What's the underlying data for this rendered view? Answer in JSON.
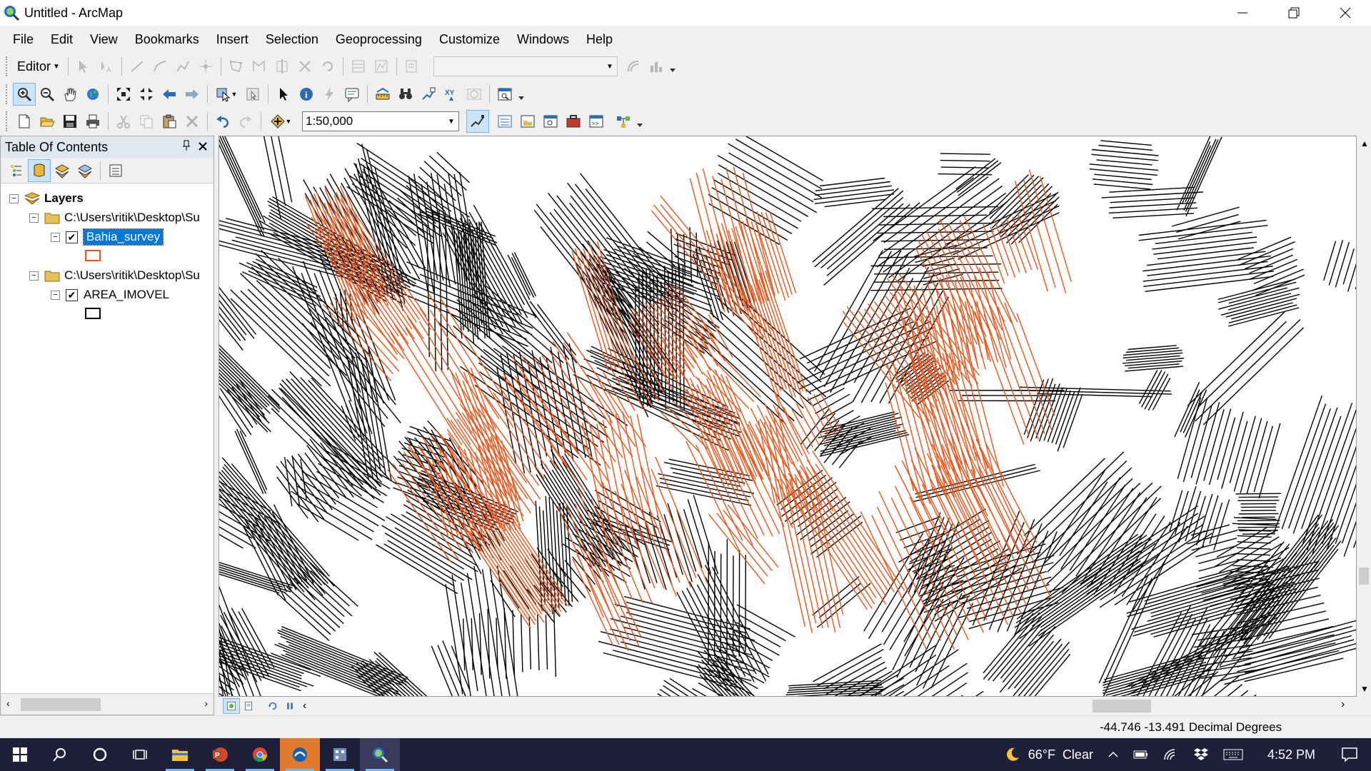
{
  "window": {
    "title": "Untitled - ArcMap"
  },
  "menu": [
    "File",
    "Edit",
    "View",
    "Bookmarks",
    "Insert",
    "Selection",
    "Geoprocessing",
    "Customize",
    "Windows",
    "Help"
  ],
  "editor_toolbar": {
    "editor_label": "Editor"
  },
  "standard_toolbar": {
    "scale_value": "1:50,000"
  },
  "toc": {
    "title": "Table Of Contents",
    "root_label": "Layers",
    "groups": [
      {
        "path": "C:\\Users\\ritik\\Desktop\\Su",
        "layer": "Bahia_survey",
        "checked": true,
        "selected": true,
        "symbol_color": "#e8561b"
      },
      {
        "path": "C:\\Users\\ritik\\Desktop\\Su",
        "layer": "AREA_IMOVEL",
        "checked": true,
        "selected": false,
        "symbol_color": "#000000"
      }
    ]
  },
  "map": {
    "layer_colors": {
      "Bahia_survey": "#e8561b",
      "AREA_IMOVEL": "#000000"
    }
  },
  "status": {
    "coordinates": "-44.746  -13.491 Decimal Degrees"
  },
  "taskbar": {
    "weather_temp": "66°F",
    "weather_text": "Clear",
    "clock": "4:52 PM"
  }
}
